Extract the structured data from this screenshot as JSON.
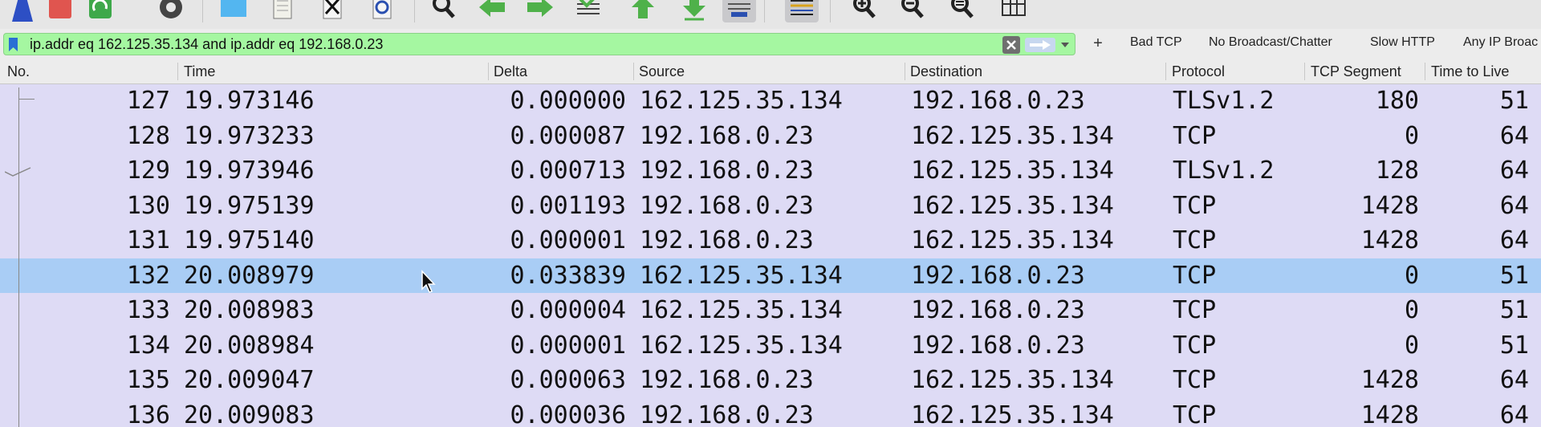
{
  "filter": {
    "value": "ip.addr eq 162.125.35.134 and ip.addr eq 192.168.0.23",
    "buttons": [
      "Bad TCP",
      "No Broadcast/Chatter",
      "Slow HTTP",
      "Any IP Broac"
    ]
  },
  "columns": [
    "No.",
    "Time",
    "Delta",
    "Source",
    "Destination",
    "Protocol",
    "TCP Segment",
    "Time to Live"
  ],
  "rows": [
    {
      "no": "127",
      "time": "19.973146",
      "delta": "0.000000",
      "src": "162.125.35.134",
      "dst": "192.168.0.23",
      "proto": "TLSv1.2",
      "seg": "180",
      "ttl": "51"
    },
    {
      "no": "128",
      "time": "19.973233",
      "delta": "0.000087",
      "src": "192.168.0.23",
      "dst": "162.125.35.134",
      "proto": "TCP",
      "seg": "0",
      "ttl": "64"
    },
    {
      "no": "129",
      "time": "19.973946",
      "delta": "0.000713",
      "src": "192.168.0.23",
      "dst": "162.125.35.134",
      "proto": "TLSv1.2",
      "seg": "128",
      "ttl": "64"
    },
    {
      "no": "130",
      "time": "19.975139",
      "delta": "0.001193",
      "src": "192.168.0.23",
      "dst": "162.125.35.134",
      "proto": "TCP",
      "seg": "1428",
      "ttl": "64"
    },
    {
      "no": "131",
      "time": "19.975140",
      "delta": "0.000001",
      "src": "192.168.0.23",
      "dst": "162.125.35.134",
      "proto": "TCP",
      "seg": "1428",
      "ttl": "64"
    },
    {
      "no": "132",
      "time": "20.008979",
      "delta": "0.033839",
      "src": "162.125.35.134",
      "dst": "192.168.0.23",
      "proto": "TCP",
      "seg": "0",
      "ttl": "51"
    },
    {
      "no": "133",
      "time": "20.008983",
      "delta": "0.000004",
      "src": "162.125.35.134",
      "dst": "192.168.0.23",
      "proto": "TCP",
      "seg": "0",
      "ttl": "51"
    },
    {
      "no": "134",
      "time": "20.008984",
      "delta": "0.000001",
      "src": "162.125.35.134",
      "dst": "192.168.0.23",
      "proto": "TCP",
      "seg": "0",
      "ttl": "51"
    },
    {
      "no": "135",
      "time": "20.009047",
      "delta": "0.000063",
      "src": "192.168.0.23",
      "dst": "162.125.35.134",
      "proto": "TCP",
      "seg": "1428",
      "ttl": "64"
    },
    {
      "no": "136",
      "time": "20.009083",
      "delta": "0.000036",
      "src": "192.168.0.23",
      "dst": "162.125.35.134",
      "proto": "TCP",
      "seg": "1428",
      "ttl": "64"
    }
  ],
  "selected_row": "132",
  "colors": {
    "row_bg": "#dedbf5",
    "selected_bg": "#a9cdf5",
    "filter_bg": "#a5f7a1"
  },
  "icons": [
    "start-capture-icon",
    "stop-capture-icon",
    "restart-capture-icon",
    "capture-options-icon",
    "open-file-icon",
    "save-file-icon",
    "close-file-icon",
    "reload-file-icon",
    "find-packet-icon",
    "go-back-icon",
    "go-forward-icon",
    "go-to-packet-icon",
    "go-first-icon",
    "go-last-icon",
    "auto-scroll-icon",
    "colorize-icon",
    "zoom-in-icon",
    "zoom-out-icon",
    "zoom-normal-icon",
    "resize-columns-icon"
  ]
}
